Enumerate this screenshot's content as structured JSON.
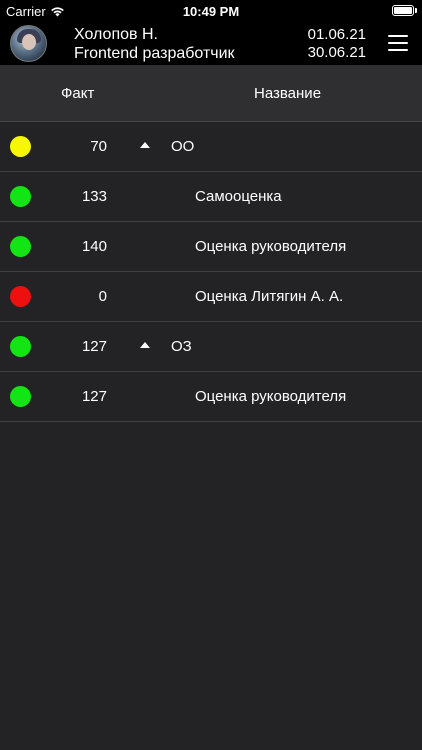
{
  "status_bar": {
    "carrier": "Carrier",
    "time": "10:49 PM",
    "wifi_icon": "wifi-icon",
    "battery_icon": "battery-icon",
    "battery_level": 1.0
  },
  "header": {
    "user_name": "Холопов Н.",
    "user_role": "Frontend разработчик",
    "date_from": "01.06.21",
    "date_to": "30.06.21",
    "menu_icon": "hamburger-menu-icon"
  },
  "table": {
    "columns": {
      "fact": "Факт",
      "name": "Название"
    },
    "rows": [
      {
        "status_color": "#f7f700",
        "fact": "70",
        "expandable": true,
        "name": "ОО",
        "level": "group"
      },
      {
        "status_color": "#13e413",
        "fact": "133",
        "expandable": false,
        "name": "Самооценка",
        "level": "child"
      },
      {
        "status_color": "#13e413",
        "fact": "140",
        "expandable": false,
        "name": "Оценка руководителя",
        "level": "child"
      },
      {
        "status_color": "#ee0f0f",
        "fact": "0",
        "expandable": false,
        "name": "Оценка Литягин А. А.",
        "level": "child"
      },
      {
        "status_color": "#13e413",
        "fact": "127",
        "expandable": true,
        "name": "ОЗ",
        "level": "group"
      },
      {
        "status_color": "#13e413",
        "fact": "127",
        "expandable": false,
        "name": "Оценка руководителя",
        "level": "child"
      }
    ]
  },
  "colors": {
    "background": "#232326",
    "header_background": "#000000",
    "table_header_background": "#2f2f32",
    "text": "#ffffff",
    "status_yellow": "#f7f700",
    "status_green": "#13e413",
    "status_red": "#ee0f0f"
  }
}
